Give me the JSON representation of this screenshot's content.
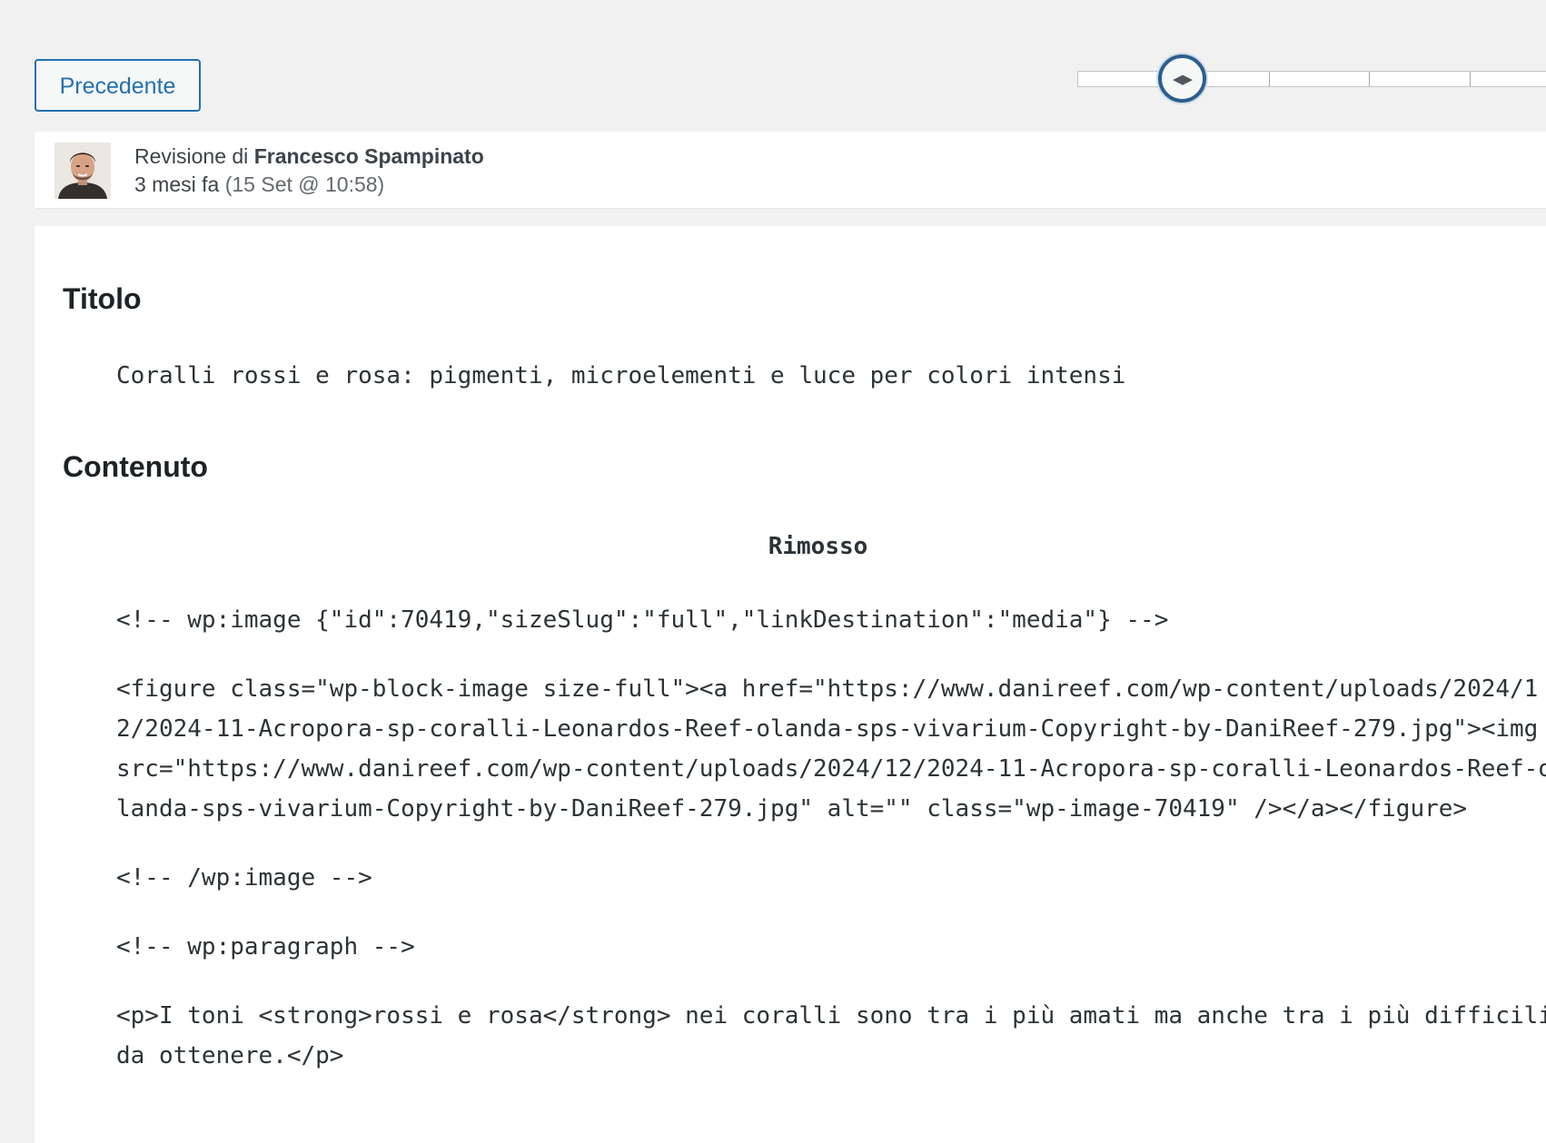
{
  "toolbar": {
    "prev_label": "Precedente"
  },
  "slider": {
    "handle_icon": "arrows-left-right-icon"
  },
  "revision": {
    "prefix": "Revisione di ",
    "author": "Francesco Spampinato",
    "time_ago": "3 mesi fa",
    "date": "(15 Set @ 10:58)"
  },
  "content": {
    "title_heading": "Titolo",
    "title_value": "Coralli rossi e rosa: pigmenti, microelementi e luce per colori intensi",
    "content_heading": "Contenuto",
    "removed_label": "Rimosso",
    "lines": [
      "<!-- wp:image {\"id\":70419,\"sizeSlug\":\"full\",\"linkDestination\":\"media\"} -->",
      "<figure class=\"wp-block-image size-full\"><a href=\"https://www.danireef.com/wp-content/uploads/2024/12/2024-11-Acropora-sp-coralli-Leonardos-Reef-olanda-sps-vivarium-Copyright-by-DaniReef-279.jpg\"><img src=\"https://www.danireef.com/wp-content/uploads/2024/12/2024-11-Acropora-sp-coralli-Leonardos-Reef-olanda-sps-vivarium-Copyright-by-DaniReef-279.jpg\" alt=\"\" class=\"wp-image-70419\" /></a></figure>",
      "<!-- /wp:image -->",
      "<!-- wp:paragraph -->",
      "<p>I toni <strong>rossi e rosa</strong> nei coralli sono tra i più amati ma anche tra i più difficili da ottenere.</p>"
    ]
  }
}
